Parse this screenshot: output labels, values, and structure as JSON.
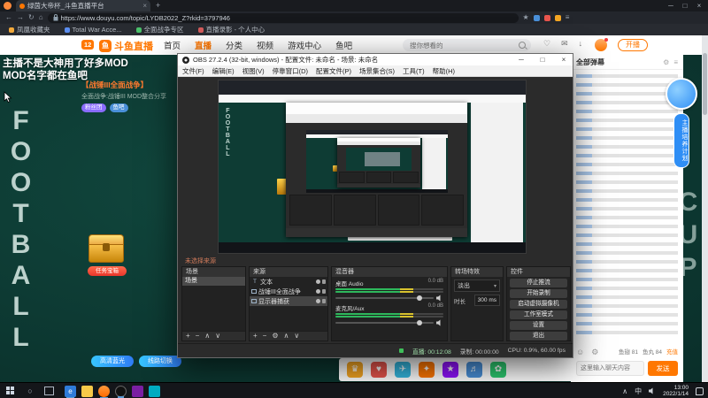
{
  "colors": {
    "accent_orange": "#ff7700",
    "page_teal": "#0d3a33",
    "obs_panel": "#2b2b2b",
    "live_green": "#3fbf5a",
    "link_blue": "#2f8ef5"
  },
  "browser": {
    "tab_title": "绿茵大帝杯_斗鱼直播平台",
    "url": "https://www.douyu.com/topic/LYDB2022_Z?rkid=3797946",
    "bookmarks": [
      "凤凰收藏夹",
      "Total War Acce...",
      "全面战争专区",
      "直播录影 - 个人中心"
    ]
  },
  "site_header": {
    "logo": "斗鱼直播",
    "level_badge": "12",
    "nav": [
      "首页",
      "直播",
      "分类",
      "视频",
      "游戏中心",
      "鱼吧"
    ],
    "search_placeholder": "搜你想看的",
    "start_live": "开播"
  },
  "page": {
    "stream_title_line1": "主播不是大神用了好多MOD",
    "stream_title_line2": "MOD名字都在鱼吧",
    "bg_text_left": "FOOTBALL",
    "bg_text_right": "CUP",
    "left_card": {
      "title": "【战锤III全面战争】",
      "subtitle": "全面战争:战锤III MOD整合分享",
      "tags": [
        "粉丝团",
        "鱼吧"
      ]
    },
    "chest_badge": "任务宝箱",
    "pills": [
      "高清蓝光",
      "线路切换"
    ],
    "chat_header": "全部弹幕",
    "mascot_label": "主播培养计划",
    "balance": [
      "鱼翅 81",
      "鱼丸 84",
      "充值"
    ],
    "chat_placeholder": "这里输入聊天内容",
    "send_label": "发送"
  },
  "obs": {
    "window_title": "OBS 27.2.4 (32-bit, windows) - 配置文件: 未命名 - 场景: 未命名",
    "menus": [
      "文件(F)",
      "编辑(E)",
      "视图(V)",
      "停靠窗口(D)",
      "配置文件(P)",
      "场景集合(S)",
      "工具(T)",
      "帮助(H)"
    ],
    "no_source_label": "未选择来源",
    "scenes": {
      "title": "场景",
      "items": [
        "场景"
      ]
    },
    "sources": {
      "title": "来源",
      "items": [
        "文本",
        "战锤III全面战争",
        "显示器捕获"
      ]
    },
    "mixer": {
      "title": "混音器",
      "channels": [
        {
          "name": "桌面 Audio",
          "db": "0.0 dB"
        },
        {
          "name": "麦克风/Aux",
          "db": "0.0 dB"
        }
      ]
    },
    "transitions": {
      "title": "转场特效",
      "selected": "淡出",
      "duration_label": "时长",
      "duration_value": "300 ms"
    },
    "controls": {
      "title": "控件",
      "buttons": [
        "停止推流",
        "开始录制",
        "启动虚拟摄像机",
        "工作室模式",
        "设置",
        "退出"
      ]
    },
    "status": {
      "live": "直播: 00:12:08",
      "rec": "录制: 00:00:00",
      "cpu": "CPU: 0.9%, 60.00 fps"
    }
  },
  "taskbar": {
    "time": "13:00",
    "date": "2022/1/14",
    "ime": "中"
  }
}
